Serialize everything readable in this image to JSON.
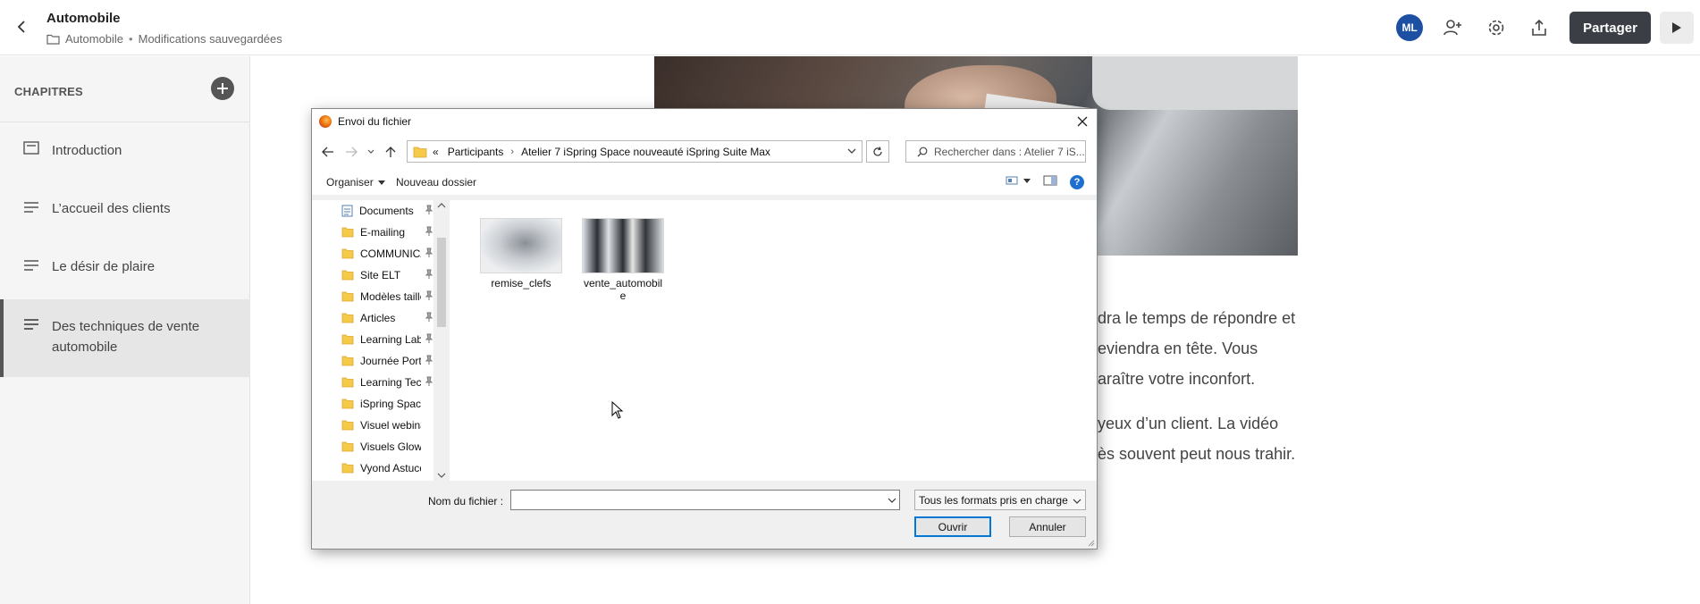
{
  "app": {
    "title": "Automobile",
    "breadcrumb_folder": "Automobile",
    "save_status": "Modifications sauvegardées",
    "separator": "•",
    "avatar_initials": "ML",
    "share_label": "Partager"
  },
  "sidebar": {
    "header": "CHAPITRES",
    "items": [
      {
        "label": "Introduction",
        "icon": "slide-icon"
      },
      {
        "label": "L’accueil des clients",
        "icon": "text-lines-icon"
      },
      {
        "label": "Le désir de plaire",
        "icon": "text-lines-icon"
      },
      {
        "label": "Des techniques de vente automobile",
        "icon": "text-lines-icon"
      }
    ]
  },
  "content": {
    "lines": [
      "dra le temps de répondre et",
      "eviendra en tête. Vous",
      "araître votre inconfort.",
      "yeux d’un client. La vidéo",
      "ès souvent peut nous trahir."
    ]
  },
  "dialog": {
    "title": "Envoi du fichier",
    "path_prefix": "«",
    "path": [
      "Participants",
      "Atelier 7 iSpring Space nouveauté iSpring Suite Max"
    ],
    "path_separator": "›",
    "search_placeholder": "Rechercher dans : Atelier 7 iS...",
    "organize_label": "Organiser",
    "new_folder_label": "Nouveau dossier",
    "help_label": "?",
    "tree": [
      {
        "label": "Documents",
        "type": "documents"
      },
      {
        "label": "E-mailing",
        "type": "folder"
      },
      {
        "label": "COMMUNICA",
        "type": "folder"
      },
      {
        "label": "Site ELT",
        "type": "folder"
      },
      {
        "label": "Modèles taille",
        "type": "folder"
      },
      {
        "label": "Articles",
        "type": "folder"
      },
      {
        "label": "Learning Lab",
        "type": "folder"
      },
      {
        "label": "Journée Porte",
        "type": "folder"
      },
      {
        "label": "Learning Tech",
        "type": "folder"
      },
      {
        "label": "iSpring Space  C",
        "type": "folder"
      },
      {
        "label": "Visuel webinars i",
        "type": "folder"
      },
      {
        "label": "Visuels Glowbl -",
        "type": "folder"
      },
      {
        "label": "Vyond  Astuces p",
        "type": "folder"
      }
    ],
    "files": [
      {
        "name": "remise_clefs"
      },
      {
        "name": "vente_automobile"
      }
    ],
    "filename_label": "Nom du fichier :",
    "filename_value": "",
    "filter_label": "Tous les formats pris en charge",
    "open_label": "Ouvrir",
    "cancel_label": "Annuler"
  },
  "colors": {
    "avatar": "#1d4fa3",
    "share_button": "#3b3e44",
    "dialog_focus": "#0078d7",
    "folder": "#f7c948"
  }
}
